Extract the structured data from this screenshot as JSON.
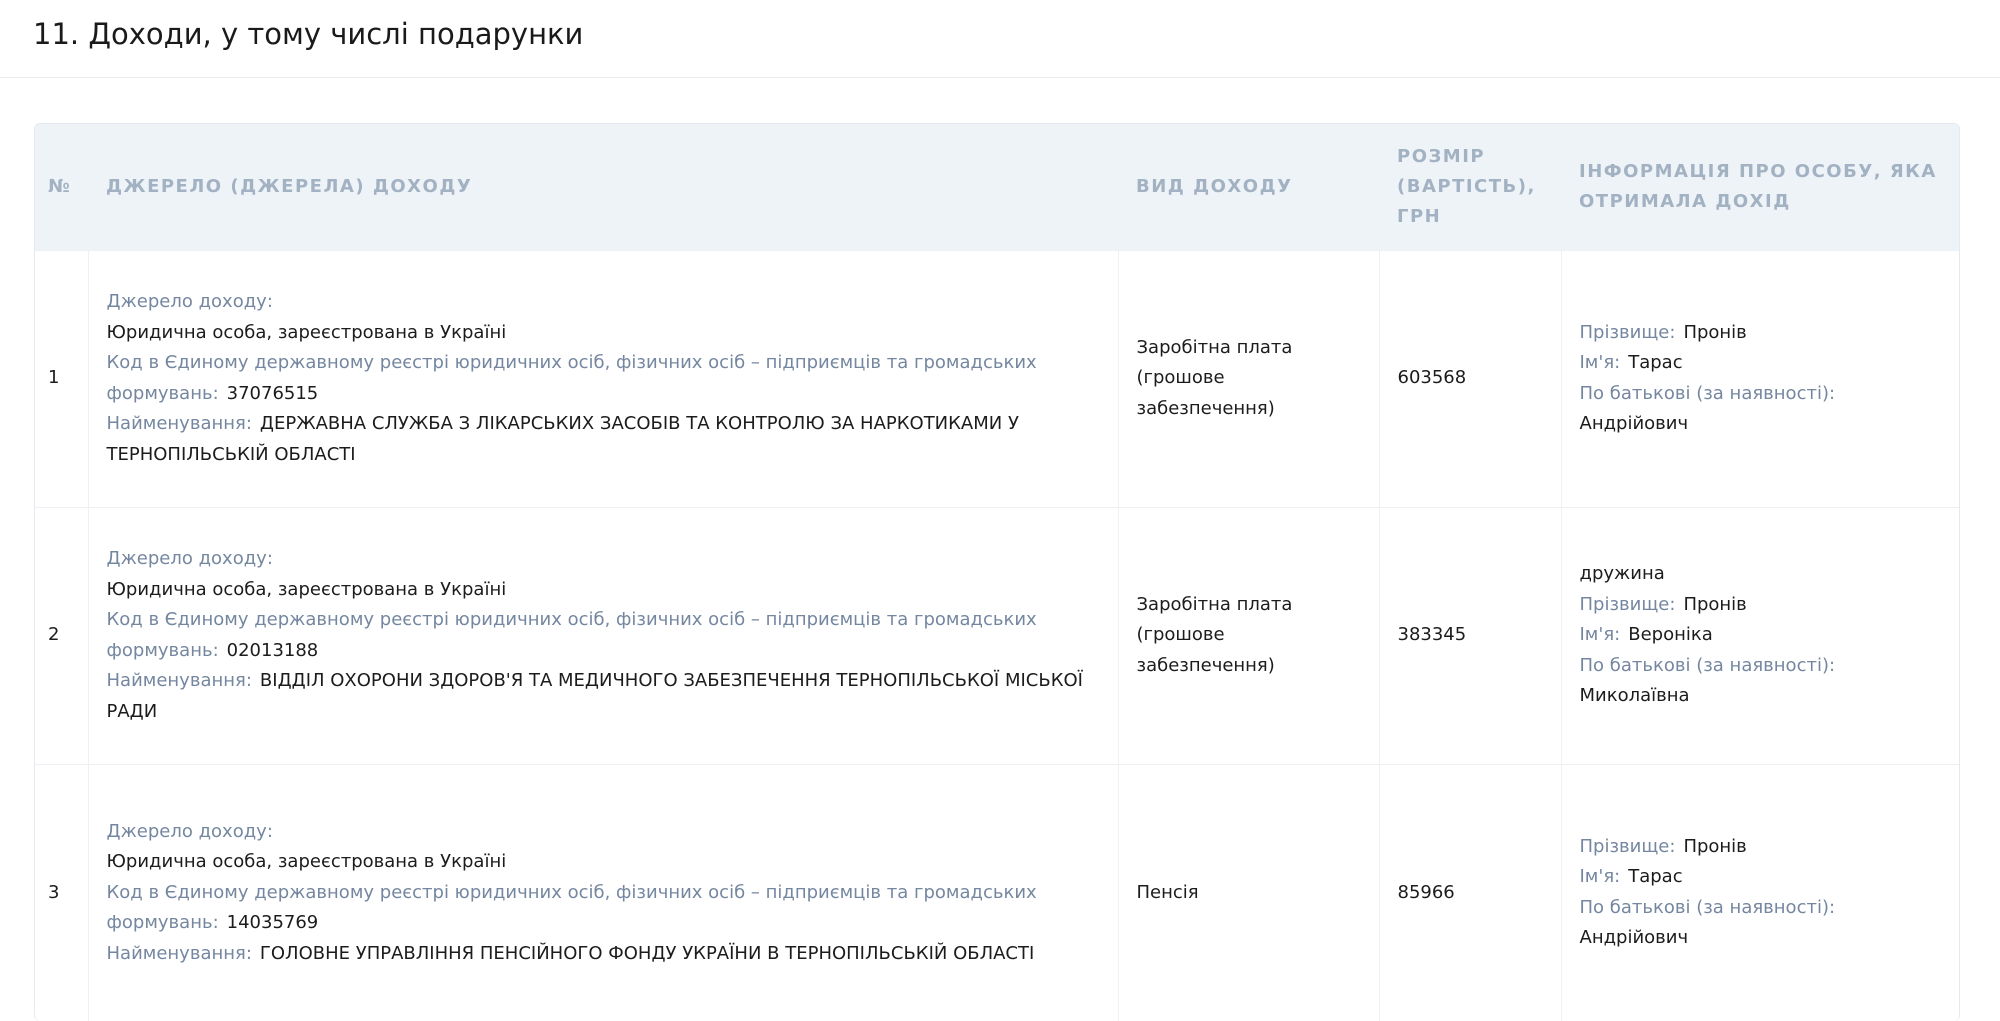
{
  "section": {
    "title": "11. Доходи, у тому числі подарунки"
  },
  "table": {
    "headers": {
      "num": "№",
      "source": "ДЖЕРЕЛО (ДЖЕРЕЛА) ДОХОДУ",
      "type": "ВИД ДОХОДУ",
      "amount": "РОЗМІР (ВАРТІСТЬ), ГРН",
      "person": "ІНФОРМАЦІЯ ПРО ОСОБУ, ЯКА ОТРИМАЛА ДОХІД"
    },
    "labels": {
      "source_label": "Джерело доходу:",
      "code_label": "Код в Єдиному державному реєстрі юридичних осіб, фізичних осіб – підприємців та громадських формувань:",
      "name_label": "Найменування:",
      "surname_label": "Прізвище:",
      "firstname_label": "Ім'я:",
      "patronymic_label": "По батькові (за наявності):"
    },
    "rows": [
      {
        "num": "1",
        "source_type": "Юридична особа, зареєстрована в Україні",
        "code": "37076515",
        "name": "ДЕРЖАВНА СЛУЖБА З ЛІКАРСЬКИХ ЗАСОБІВ ТА КОНТРОЛЮ ЗА НАРКОТИКАМИ У ТЕРНОПІЛЬСЬКІЙ ОБЛАСТІ",
        "income_type": "Заробітна плата (грошове забезпечення)",
        "amount": "603568",
        "relation": "",
        "surname": "Пронів",
        "firstname": "Тарас",
        "patronymic": "Андрійович"
      },
      {
        "num": "2",
        "source_type": "Юридична особа, зареєстрована в Україні",
        "code": "02013188",
        "name": "ВІДДІЛ ОХОРОНИ ЗДОРОВ'Я ТА МЕДИЧНОГО ЗАБЕЗПЕЧЕННЯ ТЕРНОПІЛЬСЬКОЇ МІСЬКОЇ РАДИ",
        "income_type": "Заробітна плата (грошове забезпечення)",
        "amount": "383345",
        "relation": "дружина",
        "surname": "Пронів",
        "firstname": "Вероніка",
        "patronymic": "Миколаївна"
      },
      {
        "num": "3",
        "source_type": "Юридична особа, зареєстрована в Україні",
        "code": "14035769",
        "name": "ГОЛОВНЕ УПРАВЛІННЯ ПЕНСІЙНОГО ФОНДУ УКРАЇНИ В ТЕРНОПІЛЬСЬКІЙ ОБЛАСТІ",
        "income_type": "Пенсія",
        "amount": "85966",
        "relation": "",
        "surname": "Пронів",
        "firstname": "Тарас",
        "patronymic": "Андрійович"
      }
    ]
  }
}
